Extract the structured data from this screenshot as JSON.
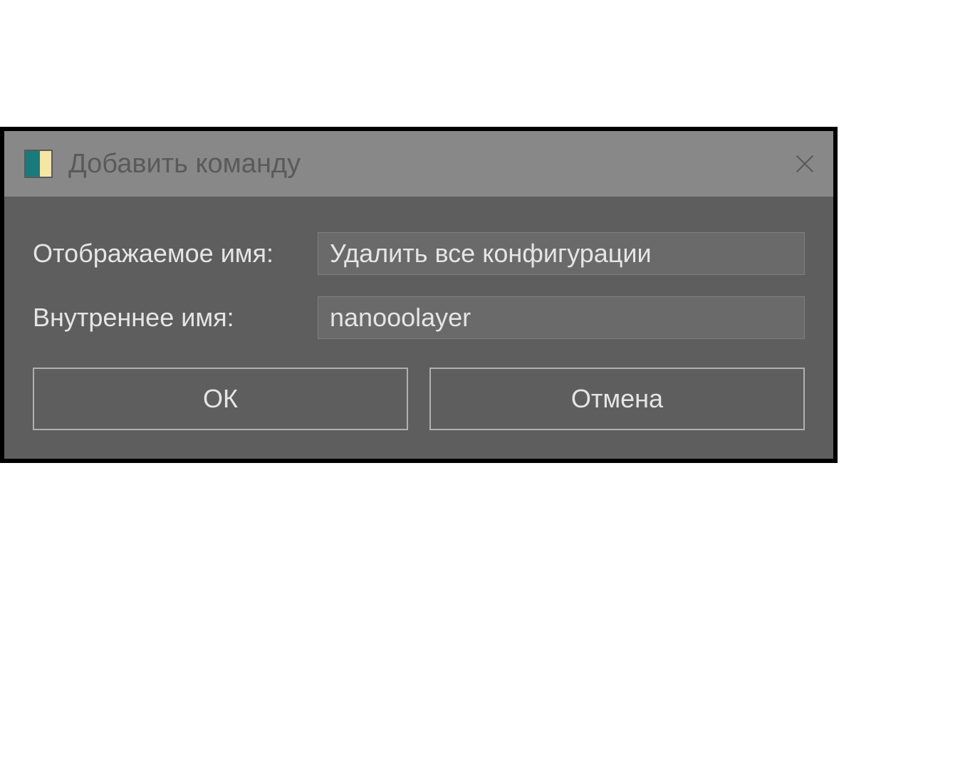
{
  "dialog": {
    "title": "Добавить команду",
    "fields": {
      "display_name": {
        "label": "Отображаемое имя:",
        "value": "Удалить все конфигурации"
      },
      "internal_name": {
        "label": "Внутреннее имя:",
        "value": "nanooolayer"
      }
    },
    "buttons": {
      "ok": "ОК",
      "cancel": "Отмена"
    }
  }
}
